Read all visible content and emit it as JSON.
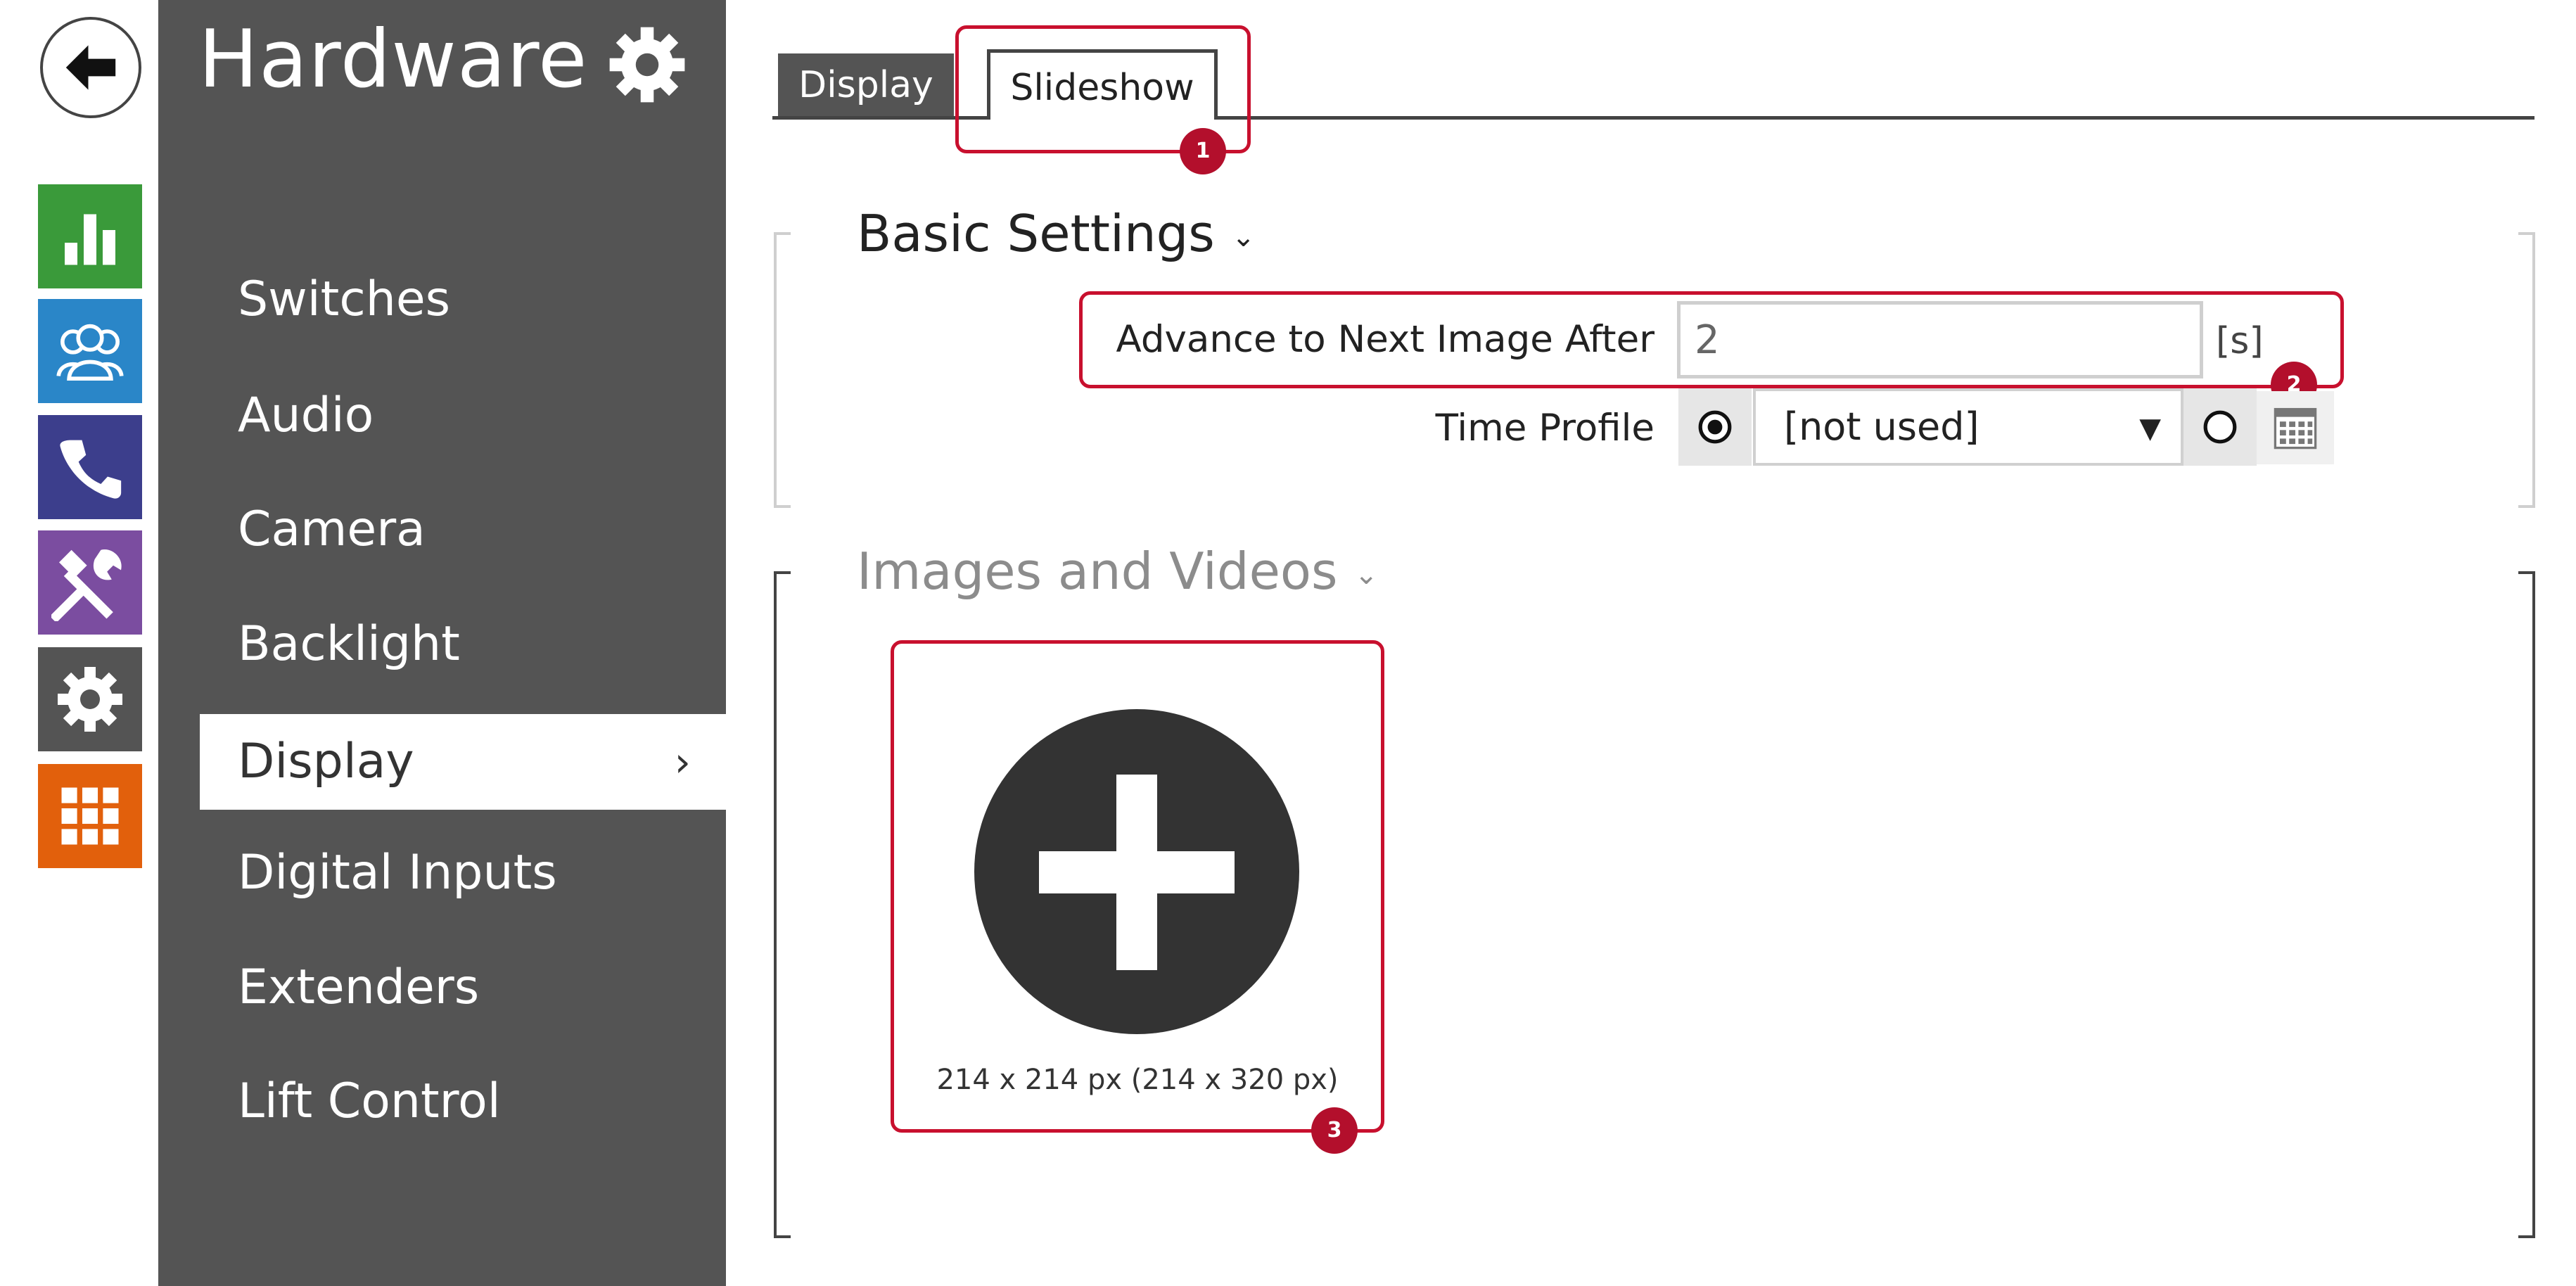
{
  "rail": {
    "back_icon": "arrow-left-icon",
    "tiles": [
      {
        "icon": "bar-chart-icon",
        "color": "#3a9a3a"
      },
      {
        "icon": "users-icon",
        "color": "#2a86c8"
      },
      {
        "icon": "phone-icon",
        "color": "#3c3e8c"
      },
      {
        "icon": "tools-icon",
        "color": "#7b4da0"
      },
      {
        "icon": "gear-icon",
        "color": "#545454"
      },
      {
        "icon": "grid-icon",
        "color": "#e2600c"
      }
    ]
  },
  "sidebar": {
    "title": "Hardware",
    "settings_icon": "gear-icon",
    "items": [
      {
        "label": "Switches",
        "active": false
      },
      {
        "label": "Audio",
        "active": false
      },
      {
        "label": "Camera",
        "active": false
      },
      {
        "label": "Backlight",
        "active": false
      },
      {
        "label": "Display",
        "active": true
      },
      {
        "label": "Digital Inputs",
        "active": false
      },
      {
        "label": "Extenders",
        "active": false
      },
      {
        "label": "Lift Control",
        "active": false
      }
    ],
    "active_chevron": "›"
  },
  "tabs": [
    {
      "label": "Display",
      "selected": false
    },
    {
      "label": "Slideshow",
      "selected": true
    }
  ],
  "basic_settings": {
    "title": "Basic Settings",
    "advance": {
      "label": "Advance to Next Image After",
      "value": "2",
      "unit": "[s]"
    },
    "time_profile": {
      "label": "Time Profile",
      "selected": "[not used]",
      "arrow": "▼",
      "radio_left_checked": true,
      "radio_right_checked": false
    }
  },
  "images_videos": {
    "title": "Images and Videos",
    "caption": "214 x 214 px (214 x 320 px)"
  },
  "callouts": {
    "one": "1",
    "two": "2",
    "three": "3",
    "color": "#c8102e"
  },
  "chevron_down": "⌄"
}
